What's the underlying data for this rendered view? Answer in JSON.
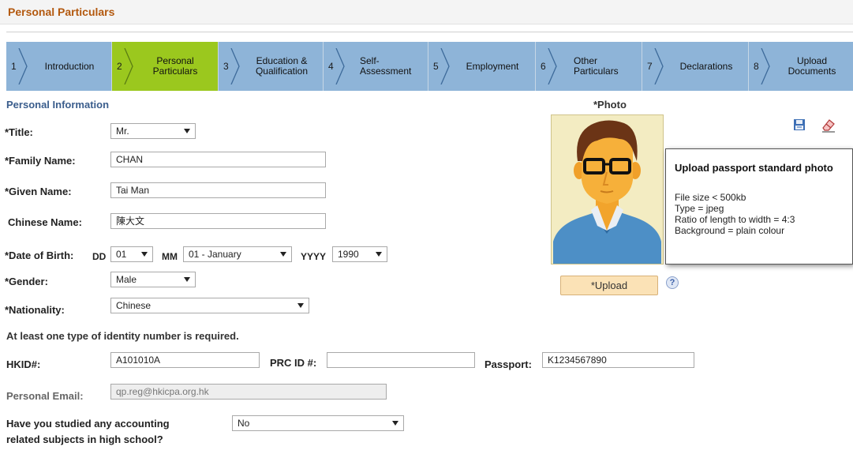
{
  "header": {
    "title": "Personal Particulars"
  },
  "steps": [
    {
      "number": "1",
      "label_line1": "Introduction",
      "label_line2": "",
      "active": false
    },
    {
      "number": "2",
      "label_line1": "Personal",
      "label_line2": "Particulars",
      "active": true
    },
    {
      "number": "3",
      "label_line1": "Education &",
      "label_line2": "Qualification",
      "active": false
    },
    {
      "number": "4",
      "label_line1": "Self-",
      "label_line2": "Assessment",
      "active": false
    },
    {
      "number": "5",
      "label_line1": "Employment",
      "label_line2": "",
      "active": false
    },
    {
      "number": "6",
      "label_line1": "Other",
      "label_line2": "Particulars",
      "active": false
    },
    {
      "number": "7",
      "label_line1": "Declarations",
      "label_line2": "",
      "active": false
    },
    {
      "number": "8",
      "label_line1": "Upload",
      "label_line2": "Documents",
      "active": false
    }
  ],
  "section": {
    "title": "Personal Information"
  },
  "form": {
    "title_label": "*Title:",
    "title_value": "Mr.",
    "family_label": "*Family Name:",
    "family_value": "CHAN",
    "given_label": "*Given Name:",
    "given_value": "Tai Man",
    "chinese_label": "Chinese Name:",
    "chinese_value": "陳大文",
    "dob_label": "*Date of Birth:",
    "dd_label": "DD",
    "dd_value": "01",
    "mm_label": "MM",
    "mm_value": "01 - January",
    "yyyy_label": "YYYY",
    "yyyy_value": "1990",
    "gender_label": "*Gender:",
    "gender_value": "Male",
    "nationality_label": "*Nationality:",
    "nationality_value": "Chinese",
    "identity_note": "At least one type of identity number is required.",
    "hkid_label": "HKID#:",
    "hkid_value": "A101010A",
    "prc_label": "PRC ID #:",
    "prc_value": "",
    "passport_label": "Passport:",
    "passport_value": "K1234567890",
    "email_label": "Personal Email:",
    "email_value": "qp.reg@hkicpa.org.hk",
    "studied_label_line1": "Have you studied any accounting",
    "studied_label_line2": "related subjects in high school?",
    "studied_value": "No"
  },
  "photo": {
    "label": "*Photo",
    "upload_label": "*Upload",
    "help_icon": "?",
    "tooltip": {
      "title": "Upload passport standard photo",
      "lines": [
        "File size < 500kb",
        "Type = jpeg",
        "Ratio of length to width = 4:3",
        "Background = plain colour"
      ]
    }
  },
  "toolbar_icons": [
    "save-icon",
    "eraser-icon"
  ],
  "colors": {
    "title": "#b3590f",
    "step_bg": "#8eb4d8",
    "step_active": "#9bc81e",
    "section": "#3a5d8c",
    "upload_btn": "#fbe2b6"
  }
}
